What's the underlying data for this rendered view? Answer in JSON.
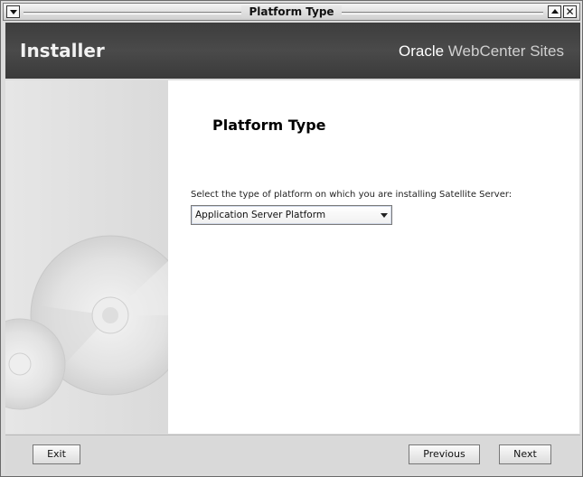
{
  "window": {
    "title": "Platform Type"
  },
  "header": {
    "title": "Installer",
    "brand_company": "Oracle",
    "brand_product": "WebCenter Sites"
  },
  "main": {
    "page_title": "Platform Type",
    "prompt": "Select the type of platform on which you are installing Satellite Server:",
    "platform_select": {
      "selected": "Application Server Platform"
    }
  },
  "footer": {
    "exit_label": "Exit",
    "previous_label": "Previous",
    "next_label": "Next"
  },
  "colors": {
    "header_bg": "#444444",
    "content_bg": "#ffffff",
    "side_bg": "#e0e0e0"
  }
}
